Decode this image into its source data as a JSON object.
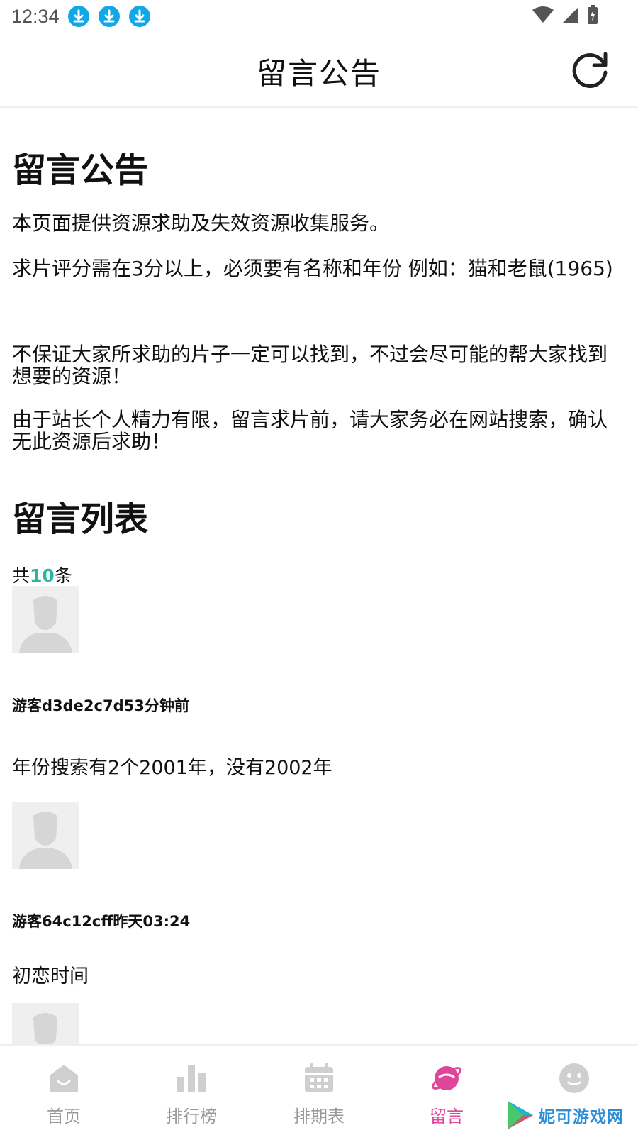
{
  "status_bar": {
    "time": "12:34",
    "icons": [
      "download-icon",
      "download-icon",
      "download-icon",
      "wifi-icon",
      "signal-icon",
      "battery-icon"
    ]
  },
  "header": {
    "title": "留言公告",
    "refresh_icon": "refresh-icon"
  },
  "notice": {
    "heading": "留言公告",
    "paragraphs": [
      "本页面提供资源求助及失效资源收集服务。",
      "求片评分需在3分以上，必须要有名称和年份 例如：猫和老鼠(1965)",
      "不保证大家所求助的片子一定可以找到，不过会尽可能的帮大家找到想要的资源！",
      "由于站长个人精力有限，留言求片前，请大家务必在网站搜索，确认无此资源后求助！"
    ]
  },
  "messages": {
    "heading": "留言列表",
    "count_prefix": "共",
    "count": "10",
    "count_suffix": "条",
    "items": [
      {
        "meta": "游客d3de2c7d53分钟前",
        "text": "年份搜索有2个2001年，没有2002年"
      },
      {
        "meta": "游客64c12cff昨天03:24",
        "text": "初恋时间"
      },
      {
        "meta": "",
        "text": ""
      }
    ]
  },
  "bottom_nav": {
    "items": [
      {
        "label": "首页",
        "icon": "home-icon",
        "active": false
      },
      {
        "label": "排行榜",
        "icon": "chart-icon",
        "active": false
      },
      {
        "label": "排期表",
        "icon": "calendar-icon",
        "active": false
      },
      {
        "label": "留言",
        "icon": "planet-icon",
        "active": true
      },
      {
        "label": "",
        "icon": "smiley-icon",
        "active": false
      }
    ]
  },
  "watermark": {
    "text": "妮可游戏网",
    "icon": "play-logo-icon"
  },
  "colors": {
    "accent": "#2bb5a0",
    "active_tab": "#e0459a",
    "download_badge": "#10a8e8",
    "inactive": "#999999"
  }
}
